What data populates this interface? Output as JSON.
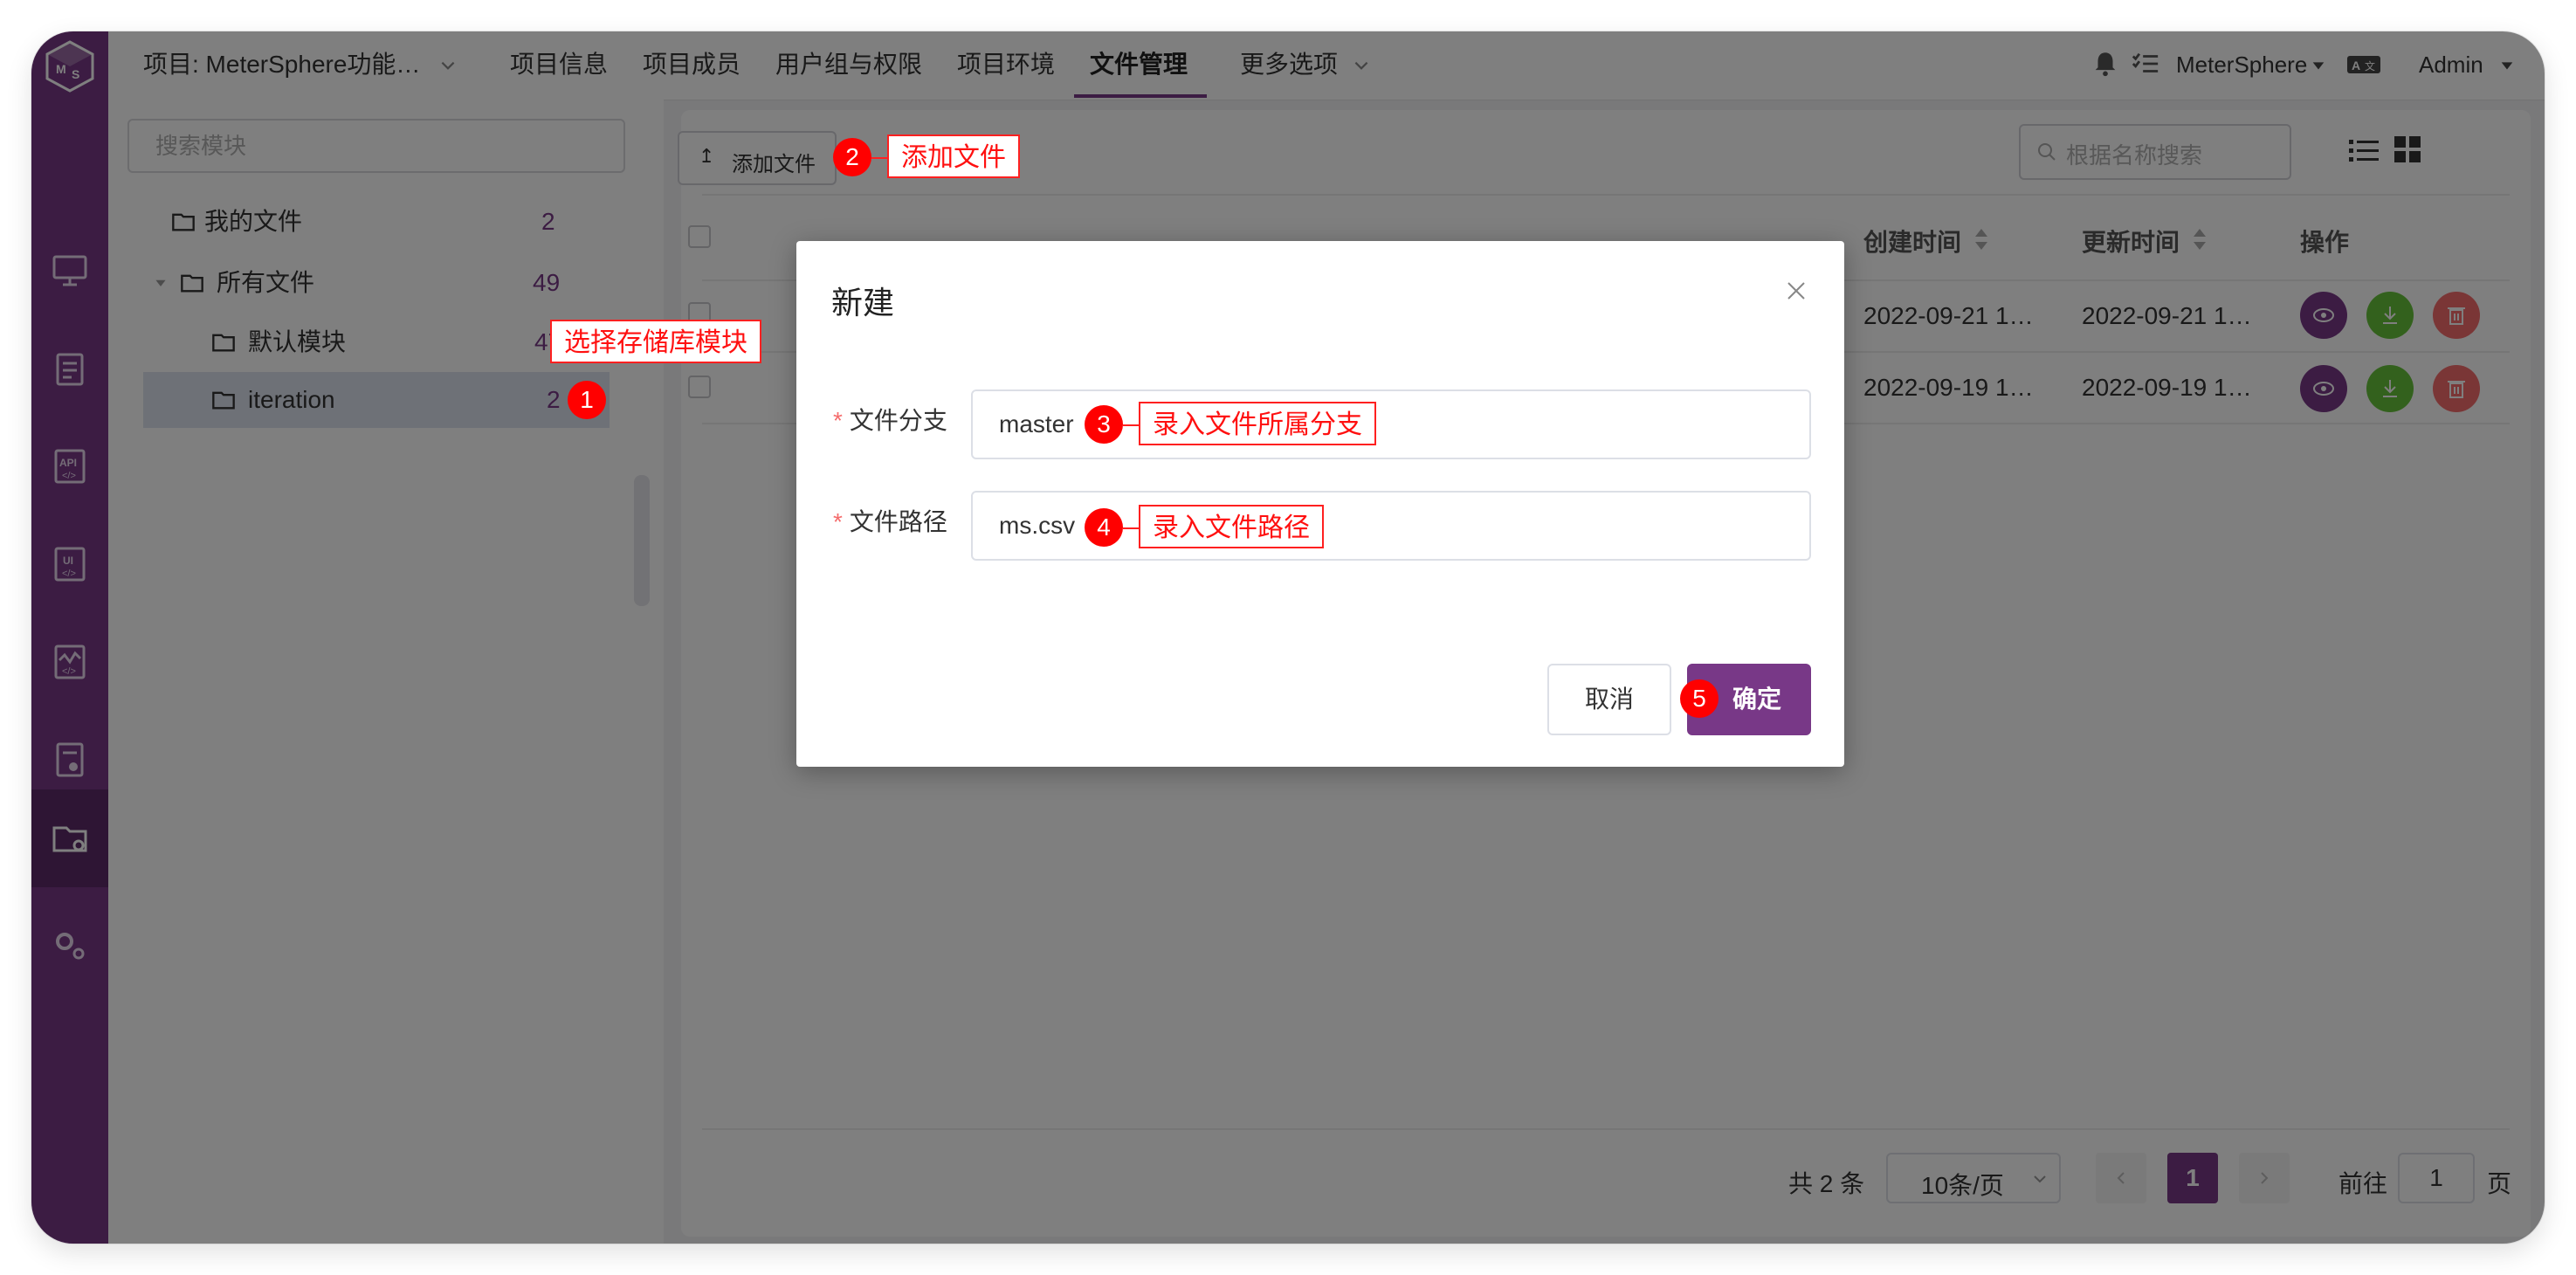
{
  "header": {
    "project_label": "项目: MeterSphere功能…",
    "nav_items": [
      "项目信息",
      "项目成员",
      "用户组与权限",
      "项目环境",
      "文件管理",
      "更多选项"
    ],
    "workspace": "MeterSphere",
    "user": "Admin"
  },
  "module_panel": {
    "search_placeholder": "搜索模块",
    "my_files": {
      "label": "我的文件",
      "count": "2"
    },
    "all_files": {
      "label": "所有文件",
      "count": "49"
    },
    "default_module": {
      "label": "默认模块",
      "count": "47"
    },
    "iteration": {
      "label": "iteration",
      "count": "2"
    }
  },
  "main": {
    "add_file_label": "添加文件",
    "search_placeholder": "根据名称搜索",
    "columns": {
      "created": "创建时间",
      "updated": "更新时间",
      "actions": "操作"
    },
    "rows": [
      {
        "created": "2022-09-21 1…",
        "updated": "2022-09-21 1…"
      },
      {
        "created": "2022-09-19 1…",
        "updated": "2022-09-19 1…"
      }
    ],
    "pagination": {
      "total": "共 2 条",
      "page_size": "10条/页",
      "current_page": "1",
      "goto_prefix": "前往",
      "goto_value": "1",
      "goto_suffix": "页"
    }
  },
  "modal": {
    "title": "新建",
    "branch_label": "文件分支",
    "branch_value": "master",
    "path_label": "文件路径",
    "path_value": "ms.csv",
    "cancel": "取消",
    "confirm": "确定"
  },
  "annotations": [
    {
      "num": "1",
      "text": "选择存储库模块"
    },
    {
      "num": "2",
      "text": "添加文件"
    },
    {
      "num": "3",
      "text": "录入文件所属分支"
    },
    {
      "num": "4",
      "text": "录入文件路径"
    },
    {
      "num": "5"
    }
  ],
  "colors": {
    "brand": "#783887",
    "annotation": "#ff0000"
  }
}
